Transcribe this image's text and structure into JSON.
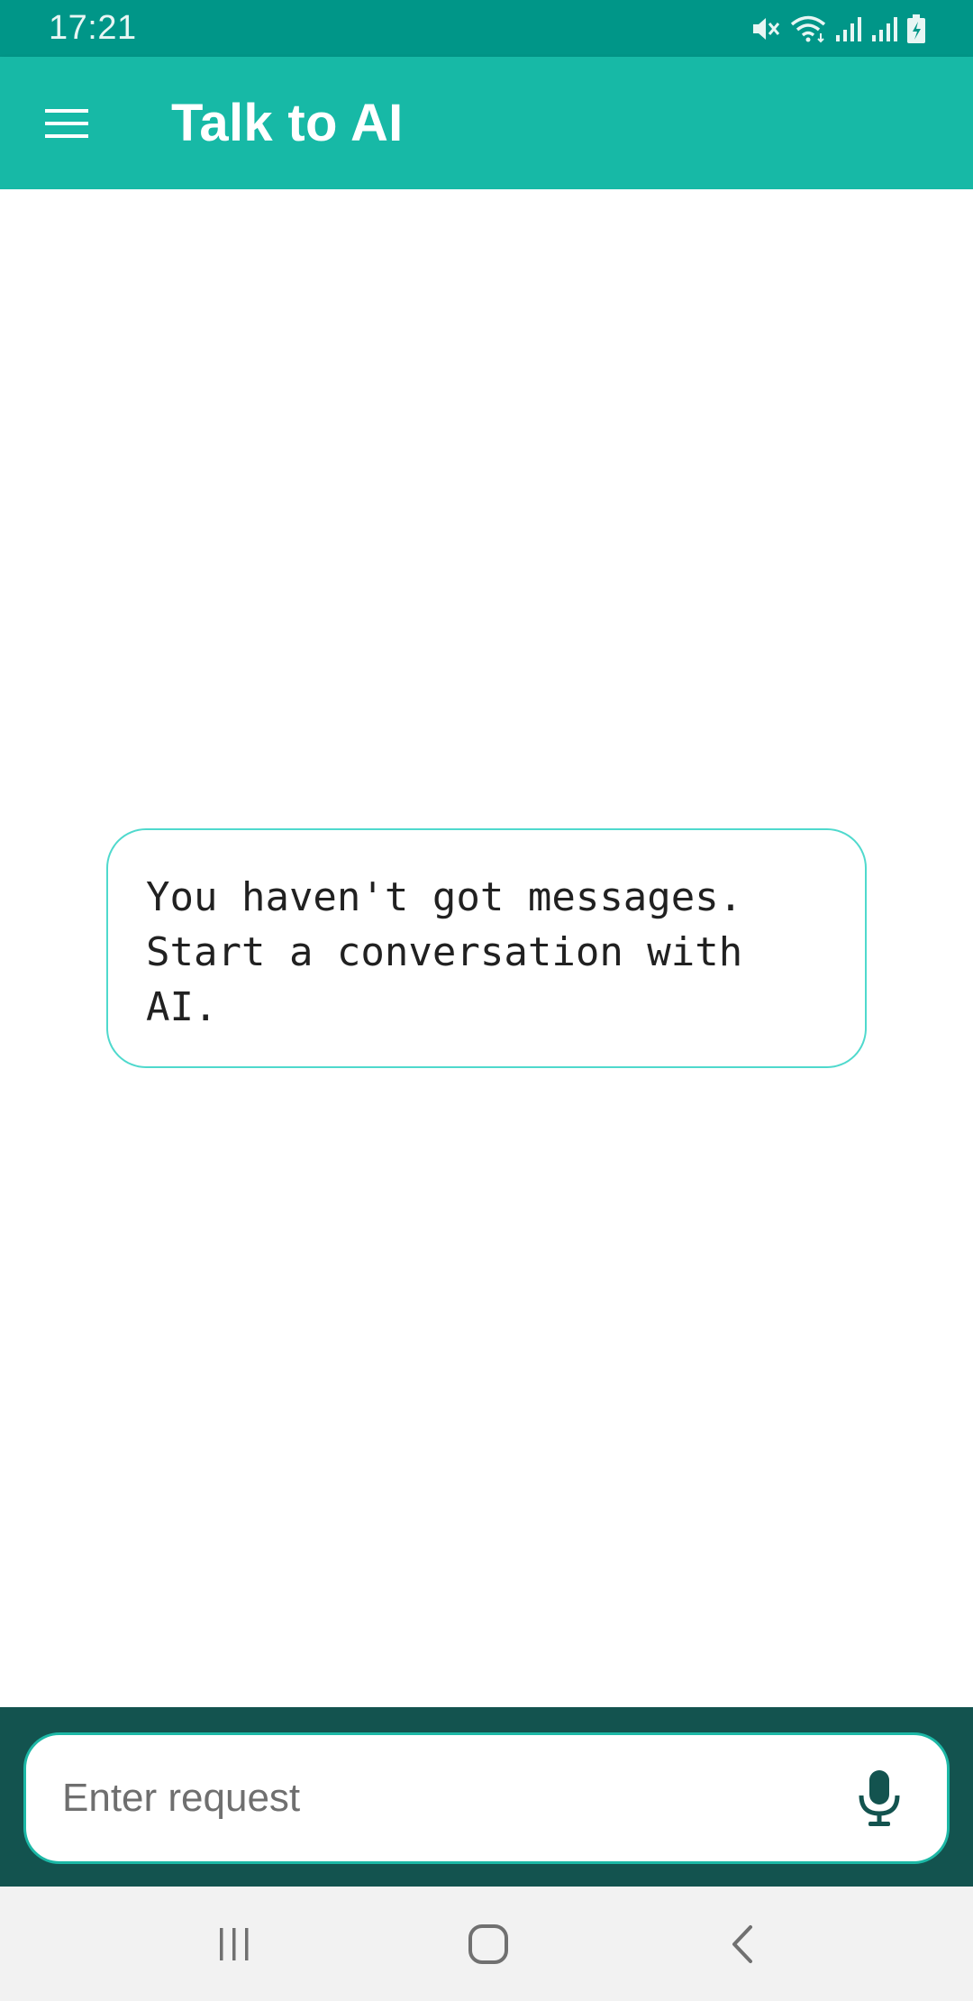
{
  "status_bar": {
    "time": "17:21",
    "icons": [
      "mute-icon",
      "wifi-icon",
      "signal-icon",
      "signal-icon",
      "battery-charging-icon"
    ]
  },
  "app_bar": {
    "menu_icon": "hamburger-menu-icon",
    "title": "Talk to AI"
  },
  "content": {
    "empty_message": "You haven't got messages.\nStart a conversation with\nAI."
  },
  "input": {
    "placeholder": "Enter request",
    "value": "",
    "mic_icon": "microphone-icon"
  },
  "nav_bar": {
    "buttons": [
      "recent-apps-icon",
      "home-icon",
      "back-icon"
    ]
  },
  "colors": {
    "status_bar": "#009688",
    "app_bar": "#17b9a6",
    "card_border": "#4fd9cd",
    "input_bar": "#13534f",
    "mic": "#13534f"
  }
}
